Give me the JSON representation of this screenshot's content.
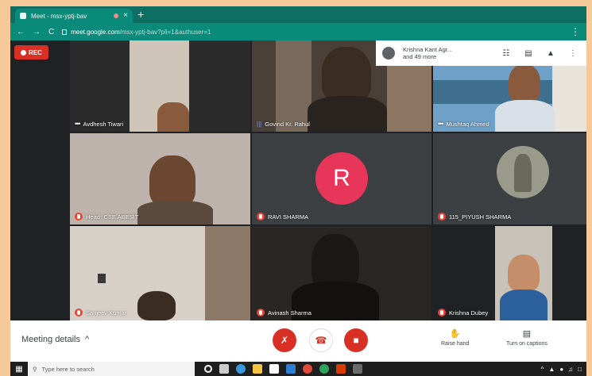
{
  "browser": {
    "tab_title": "Meet - msx-yptj-bav",
    "new_tab_symbol": "+",
    "close_symbol": "×",
    "url_host": "meet.google.com",
    "url_path": "/msx-yptj-bav?pli=1&authuser=1"
  },
  "recording": {
    "label": "REC"
  },
  "participants_panel": {
    "line1": "Krishna Kant Agr...",
    "line2": "and 49 more"
  },
  "tiles": [
    {
      "name": "Avdhesh Tiwari",
      "status": "dots"
    },
    {
      "name": "Govind Kr. Rahul",
      "status": "speaking"
    },
    {
      "name": "Mushtaq Ahmed",
      "status": "dots"
    },
    {
      "name": "Head- CSE ABESIT",
      "status": "muted"
    },
    {
      "name": "RAVI SHARMA",
      "status": "muted",
      "avatar_letter": "R"
    },
    {
      "name": "115_PIYUSH SHARMA",
      "status": "muted"
    },
    {
      "name": "Sanjeev Kumar",
      "status": "muted"
    },
    {
      "name": "Avinash Sharma",
      "status": "muted"
    },
    {
      "name": "Krishna Dubey",
      "status": "muted"
    }
  ],
  "bottom": {
    "meeting_details": "Meeting details",
    "raise_hand": "Raise hand",
    "captions": "Turn on captions"
  },
  "taskbar": {
    "search_placeholder": "Type here to search"
  },
  "colors": {
    "meet_red": "#d93025",
    "avatar_pink": "#e8365a",
    "browser_teal": "#0a8a7a"
  }
}
